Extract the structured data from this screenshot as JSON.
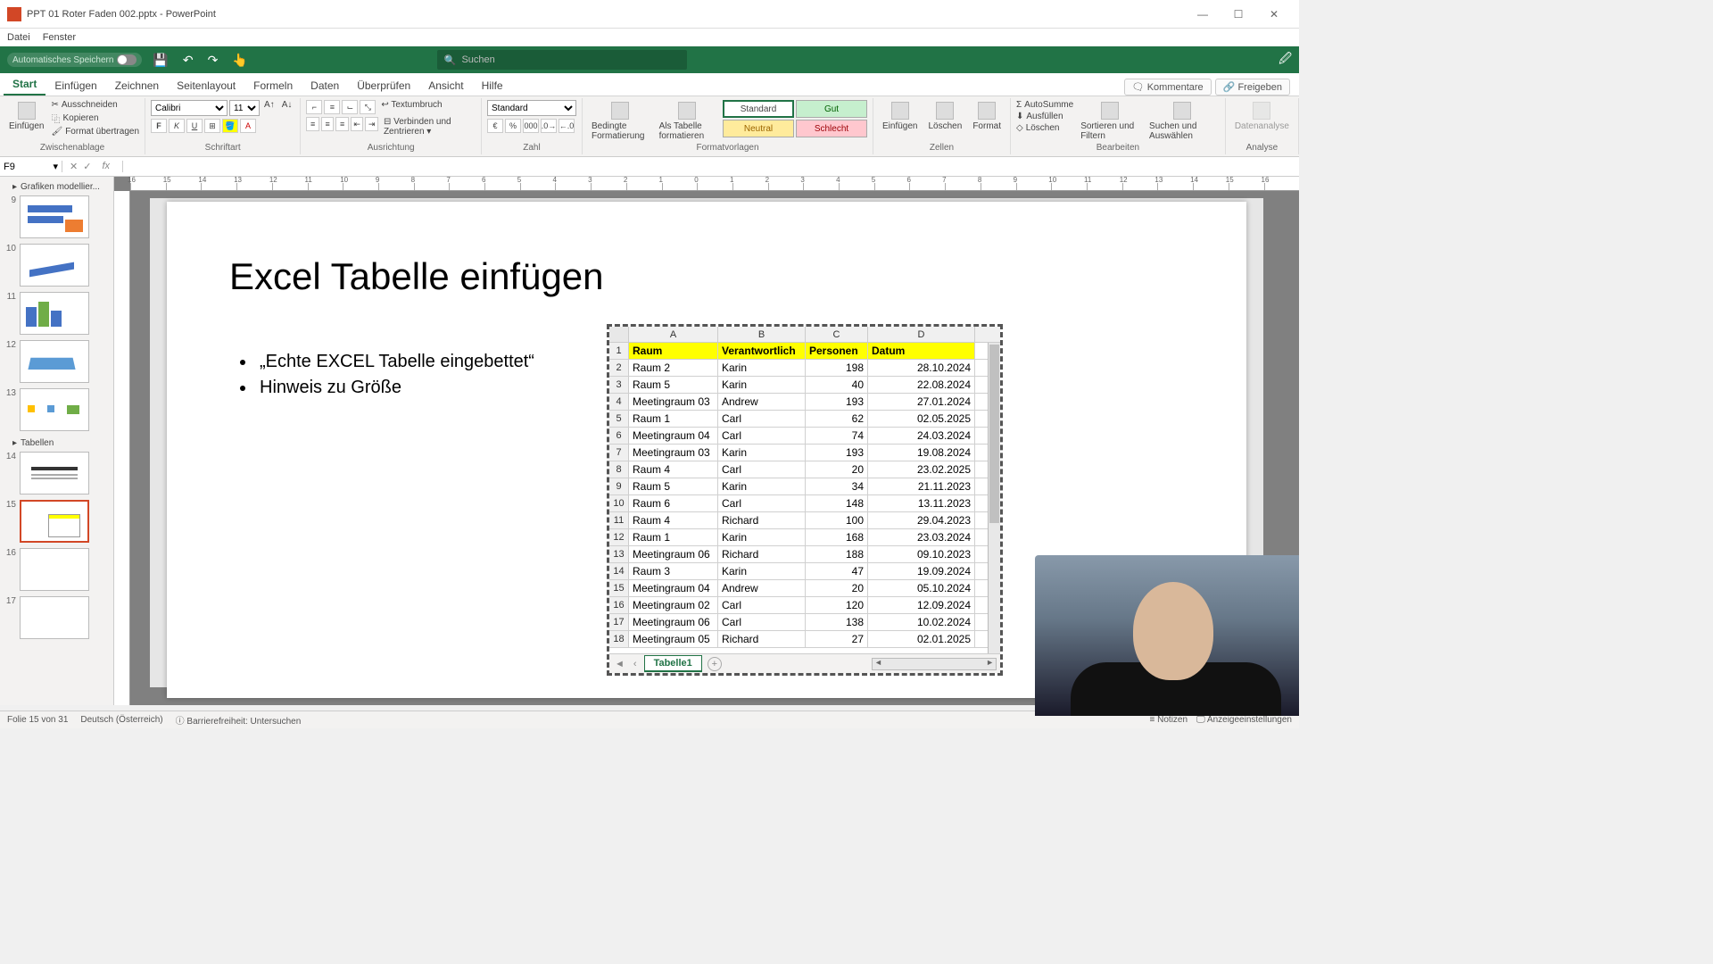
{
  "titlebar": {
    "title": "PPT 01 Roter Faden 002.pptx - PowerPoint"
  },
  "menubar": {
    "items": [
      "Datei",
      "Fenster"
    ]
  },
  "qat": {
    "autosave": "Automatisches Speichern",
    "search_placeholder": "Suchen"
  },
  "ribbon_tabs": {
    "items": [
      "Start",
      "Einfügen",
      "Zeichnen",
      "Seitenlayout",
      "Formeln",
      "Daten",
      "Überprüfen",
      "Ansicht",
      "Hilfe"
    ],
    "active": "Start",
    "comments": "Kommentare",
    "share": "Freigeben"
  },
  "ribbon": {
    "clipboard": {
      "paste": "Einfügen",
      "cut": "Ausschneiden",
      "copy": "Kopieren",
      "fmt": "Format übertragen",
      "label": "Zwischenablage"
    },
    "font": {
      "name": "Calibri",
      "size": "11",
      "label": "Schriftart"
    },
    "align": {
      "wrap": "Textumbruch",
      "merge": "Verbinden und Zentrieren",
      "label": "Ausrichtung"
    },
    "number": {
      "format": "Standard",
      "label": "Zahl"
    },
    "styles": {
      "cond": "Bedingte Formatierung",
      "astable": "Als Tabelle formatieren",
      "std": "Standard",
      "gut": "Gut",
      "neu": "Neutral",
      "sch": "Schlecht",
      "label": "Formatvorlagen"
    },
    "cells": {
      "ins": "Einfügen",
      "del": "Löschen",
      "fmt": "Format",
      "label": "Zellen"
    },
    "editing": {
      "sum": "AutoSumme",
      "fill": "Ausfüllen",
      "clear": "Löschen",
      "sort": "Sortieren und Filtern",
      "find": "Suchen und Auswählen",
      "label": "Bearbeiten"
    },
    "analysis": {
      "btn": "Datenanalyse",
      "label": "Analyse"
    }
  },
  "fbar": {
    "name": "F9",
    "fx": "fx"
  },
  "slidepanel": {
    "section1": "Grafiken modellier...",
    "section2": "Tabellen",
    "nums": [
      "9",
      "10",
      "11",
      "12",
      "13",
      "14",
      "15",
      "16",
      "17"
    ]
  },
  "slide": {
    "title": "Excel Tabelle einfügen",
    "bullets": [
      "„Echte EXCEL Tabelle eingebettet“",
      "Hinweis zu Größe"
    ]
  },
  "excel": {
    "cols": [
      "A",
      "B",
      "C",
      "D"
    ],
    "headers": [
      "Raum",
      "Verantwortlich",
      "Personen",
      "Datum"
    ],
    "rows": [
      [
        "Raum 2",
        "Karin",
        "198",
        "28.10.2024"
      ],
      [
        "Raum 5",
        "Karin",
        "40",
        "22.08.2024"
      ],
      [
        "Meetingraum 03",
        "Andrew",
        "193",
        "27.01.2024"
      ],
      [
        "Raum 1",
        "Carl",
        "62",
        "02.05.2025"
      ],
      [
        "Meetingraum 04",
        "Carl",
        "74",
        "24.03.2024"
      ],
      [
        "Meetingraum 03",
        "Karin",
        "193",
        "19.08.2024"
      ],
      [
        "Raum 4",
        "Carl",
        "20",
        "23.02.2025"
      ],
      [
        "Raum 5",
        "Karin",
        "34",
        "21.11.2023"
      ],
      [
        "Raum 6",
        "Carl",
        "148",
        "13.11.2023"
      ],
      [
        "Raum 4",
        "Richard",
        "100",
        "29.04.2023"
      ],
      [
        "Raum 1",
        "Karin",
        "168",
        "23.03.2024"
      ],
      [
        "Meetingraum 06",
        "Richard",
        "188",
        "09.10.2023"
      ],
      [
        "Raum 3",
        "Karin",
        "47",
        "19.09.2024"
      ],
      [
        "Meetingraum 04",
        "Andrew",
        "20",
        "05.10.2024"
      ],
      [
        "Meetingraum 02",
        "Carl",
        "120",
        "12.09.2024"
      ],
      [
        "Meetingraum 06",
        "Carl",
        "138",
        "10.02.2024"
      ],
      [
        "Meetingraum 05",
        "Richard",
        "27",
        "02.01.2025"
      ]
    ],
    "sheet": "Tabelle1"
  },
  "statusbar": {
    "slide": "Folie 15 von 31",
    "lang": "Deutsch (Österreich)",
    "access": "Barrierefreiheit: Untersuchen",
    "notes": "Notizen",
    "display": "Anzeigeeinstellungen"
  },
  "ruler_nums": [
    "16",
    "15",
    "14",
    "13",
    "12",
    "11",
    "10",
    "9",
    "8",
    "7",
    "6",
    "5",
    "4",
    "3",
    "2",
    "1",
    "0",
    "1",
    "2",
    "3",
    "4",
    "5",
    "6",
    "7",
    "8",
    "9",
    "10",
    "11",
    "12",
    "13",
    "14",
    "15",
    "16"
  ]
}
